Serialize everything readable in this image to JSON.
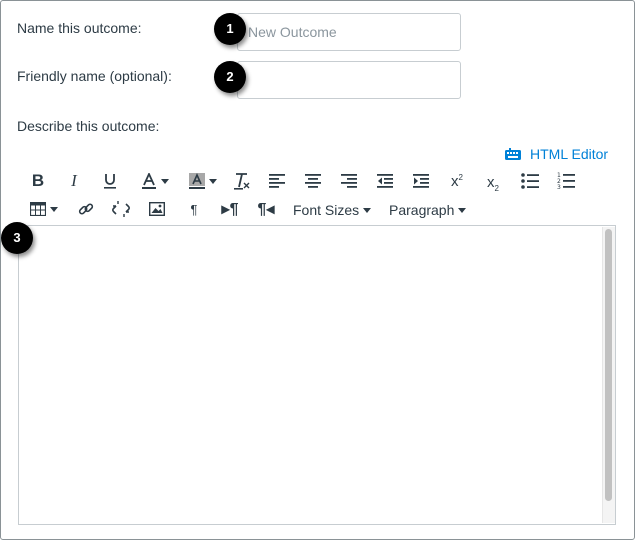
{
  "form": {
    "name_label": "Name this outcome:",
    "name_placeholder": "New Outcome",
    "name_value": "",
    "friendly_label": "Friendly name (optional):",
    "friendly_value": "",
    "describe_label": "Describe this outcome:"
  },
  "badges": [
    "1",
    "2",
    "3"
  ],
  "editor": {
    "html_editor_label": "HTML Editor",
    "font_sizes_label": "Font Sizes",
    "paragraph_label": "Paragraph",
    "content": ""
  },
  "toolbar_icons": {
    "row1": [
      "bold-icon",
      "italic-icon",
      "underline-icon",
      "text-color-icon",
      "background-color-icon",
      "clear-formatting-icon",
      "align-left-icon",
      "align-center-icon",
      "align-right-icon",
      "outdent-icon",
      "indent-icon",
      "superscript-icon",
      "subscript-icon",
      "bullet-list-icon",
      "numbered-list-icon"
    ],
    "row2": [
      "table-icon",
      "link-icon",
      "unlink-icon",
      "image-icon",
      "paragraph-mark-icon",
      "ltr-icon",
      "rtl-icon"
    ]
  },
  "colors": {
    "accent": "#0081d7",
    "text": "#2d3b45",
    "border": "#c7cdd1",
    "badge": "#000000"
  }
}
